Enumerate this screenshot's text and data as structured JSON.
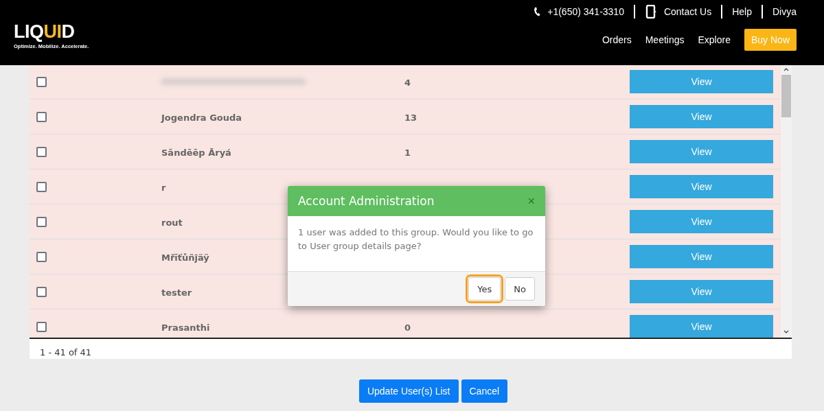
{
  "header": {
    "logo": {
      "word_start": "LIQ",
      "word_accent": "UI",
      "word_end": "D",
      "tagline": "Optimize. Mobilize. Accelerate."
    },
    "phone": "+1(650) 341-3310",
    "top_links": [
      "Contact Us",
      "Help",
      "Divya"
    ],
    "nav": [
      {
        "label": "Orders",
        "kind": "link"
      },
      {
        "label": "Meetings",
        "kind": "link"
      },
      {
        "label": "Explore",
        "kind": "link"
      },
      {
        "label": "Buy Now",
        "kind": "button"
      }
    ]
  },
  "table": {
    "rows": [
      {
        "name": null,
        "redacted": true,
        "count": "4",
        "checked": false,
        "action": "View"
      },
      {
        "name": "Jogendra Gouda",
        "count": "13",
        "checked": false,
        "action": "View"
      },
      {
        "name": "Sāndēēp Āryá",
        "count": "1",
        "checked": false,
        "action": "View"
      },
      {
        "name": "r",
        "count": null,
        "checked": false,
        "action": "View"
      },
      {
        "name": "rout",
        "count": null,
        "checked": false,
        "action": "View"
      },
      {
        "name": "Mřīťůñĵäÿ",
        "count": null,
        "checked": false,
        "action": "View"
      },
      {
        "name": "tester",
        "count": null,
        "checked": false,
        "action": "View"
      },
      {
        "name": "Prasanthi",
        "count": "0",
        "checked": false,
        "action": "View"
      }
    ],
    "pager": "1 - 41 of 41"
  },
  "actions": [
    "Update User(s) List",
    "Cancel"
  ],
  "dialog": {
    "title": "Account Administration",
    "close": "×",
    "message": "1 user was added to this group. Would you like to go to User group details page?",
    "buttons": [
      {
        "label": "Yes",
        "focused": true
      },
      {
        "label": "No",
        "focused": false
      }
    ]
  }
}
